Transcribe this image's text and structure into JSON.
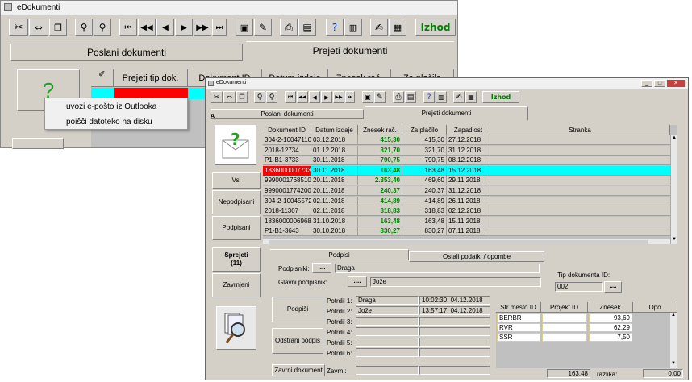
{
  "back_window": {
    "title": "eDokumenti",
    "izhod": "Izhod",
    "tab_poslani": "Poslani dokumenti",
    "tab_prejeti": "Prejeti dokumenti",
    "section_a": "A",
    "col_prejeti_tip": "Prejeti tip dok.",
    "col_dokument_id": "Dokument ID",
    "col_datum": "Datum izdaje",
    "col_znesek": "Znesek rač.",
    "col_zaplacilo": "Za plačilo"
  },
  "context_menu": {
    "items": [
      "uvozi e-pošto iz Outlooka",
      "poišči datoteko na disku"
    ]
  },
  "front_window": {
    "title": "eDokumenti",
    "izhod": "Izhod",
    "section_a": "A",
    "tabs": [
      "Poslani dokumenti",
      "Prejeti dokumenti"
    ],
    "filters": [
      "Vsi",
      "Nepodpisani",
      "Podpisani",
      "Sprejeti\n(11)",
      "Zavrnjeni"
    ],
    "columns": [
      "Dokument ID",
      "Datum izdaje",
      "Znesek rač.",
      "Za plačilo",
      "Zapadlost",
      "Stranka"
    ],
    "rows": [
      [
        "304-2-10047110",
        "03.12.2018",
        "415,30",
        "415,30",
        "27.12.2018"
      ],
      [
        "2018-12734",
        "01.12.2018",
        "321,70",
        "321,70",
        "31.12.2018"
      ],
      [
        "P1-B1-3733",
        "30.11.2018",
        "790,75",
        "790,75",
        "08.12.2018"
      ],
      [
        "1836000007733",
        "30.11.2018",
        "163,48",
        "163,48",
        "15.12.2018"
      ],
      [
        "9990001768510",
        "20.11.2018",
        "2.353,40",
        "469,60",
        "29.11.2018"
      ],
      [
        "9990001774200",
        "20.11.2018",
        "240,37",
        "240,37",
        "31.12.2018"
      ],
      [
        "304-2-10045572",
        "02.11.2018",
        "414,89",
        "414,89",
        "26.11.2018"
      ],
      [
        "2018-11307",
        "02.11.2018",
        "318,83",
        "318,83",
        "02.12.2018"
      ],
      [
        "1836000006968",
        "31.10.2018",
        "163,48",
        "163,48",
        "15.11.2018"
      ],
      [
        "P1-B1-3643",
        "30.10.2018",
        "830,27",
        "830,27",
        "07.11.2018"
      ]
    ],
    "bottom_tabs": [
      "Podpisi",
      "Ostali podatki / opombe"
    ],
    "podpisniki_label": "Podpisniki:",
    "podpisniki_value": "Draga",
    "glavni_label": "Glavni podpisnik:",
    "glavni_value": "Jože",
    "dots": "....",
    "tip_label": "Tip dokumenta ID:",
    "tip_value": "002",
    "podpisi_btn": "Podpiši",
    "odstrani_btn": "Odstrani podpis",
    "zavrni_btn": "Zavrni dokument",
    "zavrni_label": "Zavrni:",
    "potrdil_labels": [
      "Potrdil 1:",
      "Potrdil 2:",
      "Potrdil 3:",
      "Potrdil 4:",
      "Potrdil 5:",
      "Potrdil 6:"
    ],
    "potrdil_names": [
      "Draga",
      "Jože",
      "",
      "",
      "",
      ""
    ],
    "potrdil_times": [
      "10:02:30, 04.12.2018",
      "13:57:17, 04.12.2018",
      "",
      "",
      "",
      ""
    ],
    "cost_cols": [
      "Str mesto ID",
      "Projekt ID",
      "Znesek",
      "Opo"
    ],
    "cost_rows": [
      [
        "BERBR",
        "",
        "93,69"
      ],
      [
        "RVR",
        "",
        "62,29"
      ],
      [
        "SSR",
        "",
        "7,50"
      ]
    ],
    "total": "163,48",
    "razlika_label": "razlika:",
    "razlika_value": "0,00"
  },
  "colors": {
    "selected_row": "#00ffff",
    "red_cell": "#ff0000",
    "green_amount": "#008000",
    "izhod": "#008000"
  }
}
